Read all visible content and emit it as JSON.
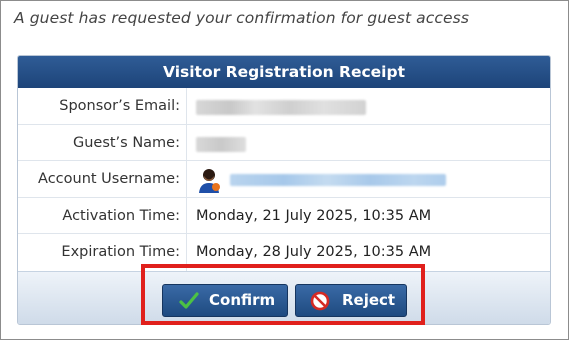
{
  "intro_text": "A guest has requested your confirmation for guest access",
  "receipt": {
    "title": "Visitor Registration Receipt",
    "rows": [
      {
        "label": "Sponsor’s Email:",
        "value": ""
      },
      {
        "label": "Guest’s Name:",
        "value": ""
      },
      {
        "label": "Account Username:",
        "value": ""
      },
      {
        "label": "Activation Time:",
        "value": "Monday, 21 July 2025, 10:35 AM"
      },
      {
        "label": "Expiration Time:",
        "value": "Monday, 28 July 2025, 10:35 AM"
      }
    ]
  },
  "actions": {
    "confirm_label": "Confirm",
    "reject_label": "Reject",
    "confirm_icon": "checkmark-icon",
    "reject_icon": "prohibited-icon"
  },
  "colors": {
    "header_blue": "#1d4479",
    "button_blue": "#2a5a94",
    "highlight_red": "#e0201c",
    "check_green": "#3ea63a"
  },
  "icons": {
    "username": "user-avatar-icon"
  }
}
